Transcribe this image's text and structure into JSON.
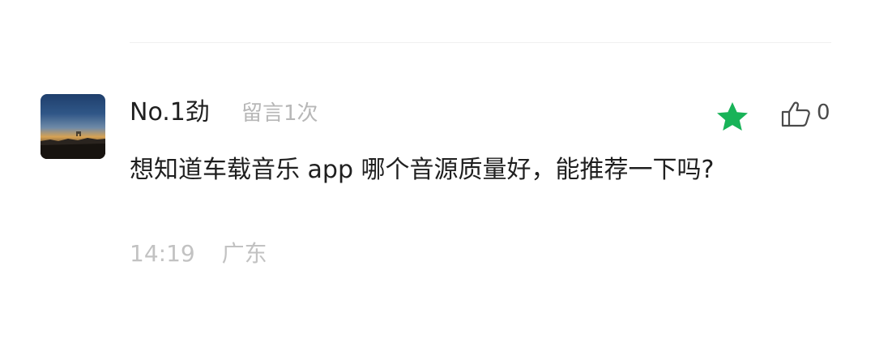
{
  "comment": {
    "user_name": "No.1劲",
    "message_count": "留言1次",
    "content": "想知道车载音乐 app 哪个音源质量好，能推荐一下吗?",
    "time": "14:19",
    "location": "广东",
    "like_count": "0"
  },
  "icons": {
    "star": "star-icon",
    "like": "thumbs-up-icon"
  },
  "colors": {
    "star": "#18b358",
    "name": "#1f1f1f",
    "secondary": "#b7b7b7",
    "divider": "#f0f0f0"
  }
}
